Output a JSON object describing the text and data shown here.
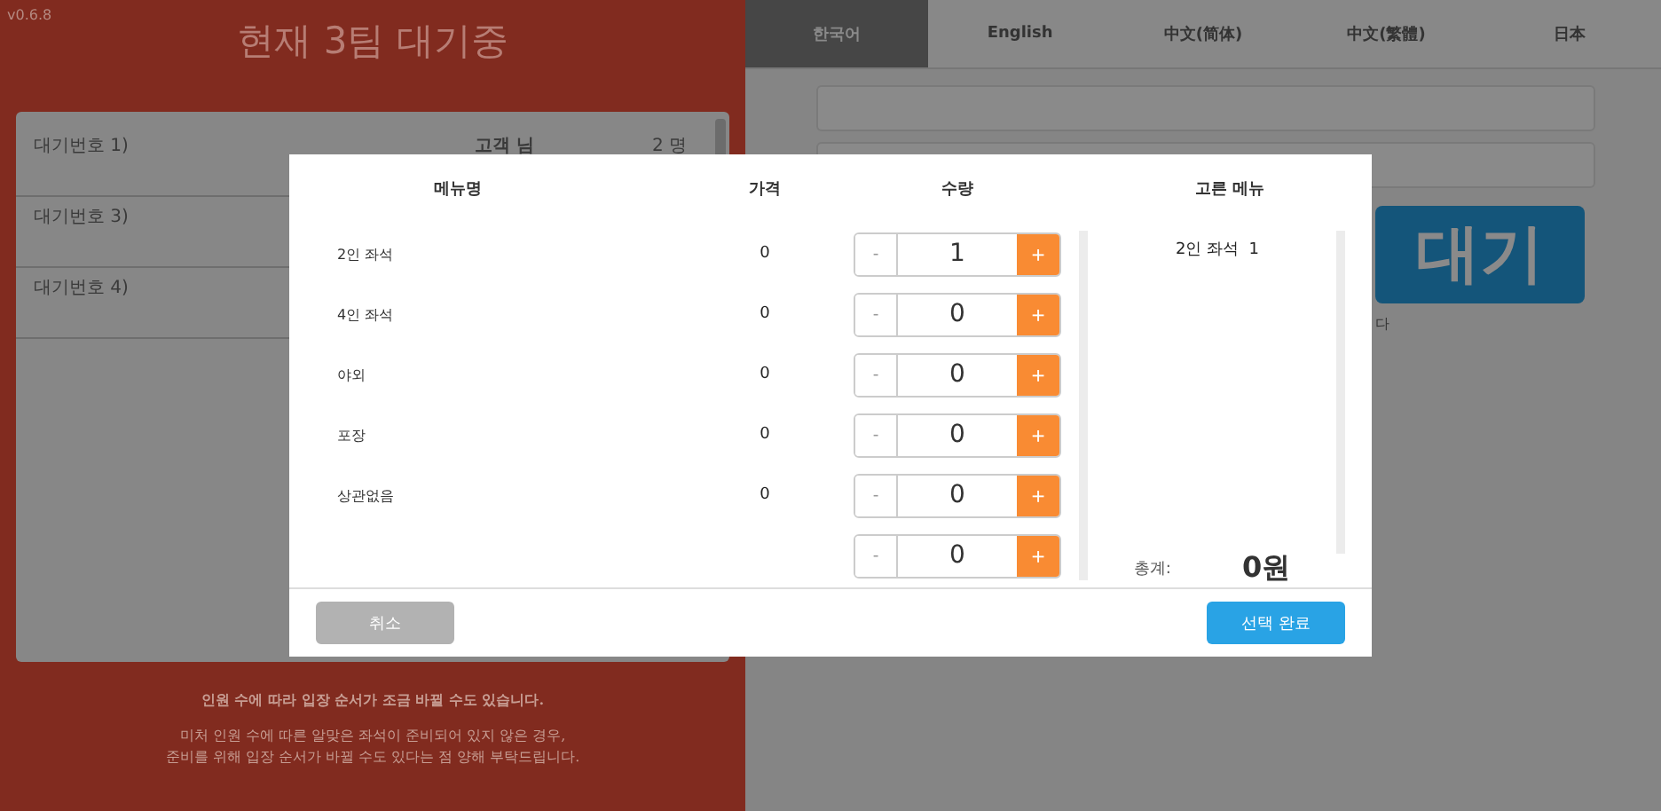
{
  "version": "v0.6.8",
  "header": {
    "title": "현재 3팀 대기중"
  },
  "queue": [
    {
      "number": "대기번호 1)",
      "customer": "고객 님",
      "people": "2 명"
    },
    {
      "number": "대기번호 3)"
    },
    {
      "number": "대기번호 4)"
    }
  ],
  "notices": [
    {
      "kind": "main",
      "text": "인원 수에 따라 입장 순서가 조금 바뀔 수도 있습니다."
    },
    {
      "kind": "detail",
      "text": "미처 인원 수에 따른 알맞은 좌석이 준비되어 있지 않은 경우,"
    },
    {
      "kind": "detail",
      "text": "준비를 위해 입장 순서가 바뀔 수도 있다는 점 양해 부탁드립니다."
    }
  ],
  "languages": [
    {
      "label": "한국어",
      "selected": true
    },
    {
      "label": "English",
      "selected": false
    },
    {
      "label": "中文(简体)",
      "selected": false
    },
    {
      "label": "中文(繁體)",
      "selected": false
    },
    {
      "label": "日本",
      "selected": false
    }
  ],
  "wait_button": "대기",
  "wait_hint": "다",
  "modal": {
    "columns": [
      "메뉴명",
      "가격",
      "수량",
      "고른 메뉴"
    ],
    "items": [
      {
        "name": "2인 좌석",
        "price": "0",
        "minus": "-",
        "quantity": "1",
        "plus": "+"
      },
      {
        "name": "4인 좌석",
        "price": "0",
        "minus": "-",
        "quantity": "0",
        "plus": "+"
      },
      {
        "name": "야외",
        "price": "0",
        "minus": "-",
        "quantity": "0",
        "plus": "+"
      },
      {
        "name": "포장",
        "price": "0",
        "minus": "-",
        "quantity": "0",
        "plus": "+"
      },
      {
        "name": "상관없음",
        "price": "0",
        "minus": "-",
        "quantity": "0",
        "plus": "+"
      },
      {
        "minus": "-",
        "quantity": "0",
        "plus": "+"
      }
    ],
    "selected_items": [
      {
        "name": "2인 좌석",
        "quantity": "1"
      }
    ],
    "total_label": "총계:",
    "total": "0원",
    "buttons": [
      {
        "kind": "cancel",
        "label": "취소"
      },
      {
        "kind": "confirm",
        "label": "선택 완료"
      }
    ]
  }
}
